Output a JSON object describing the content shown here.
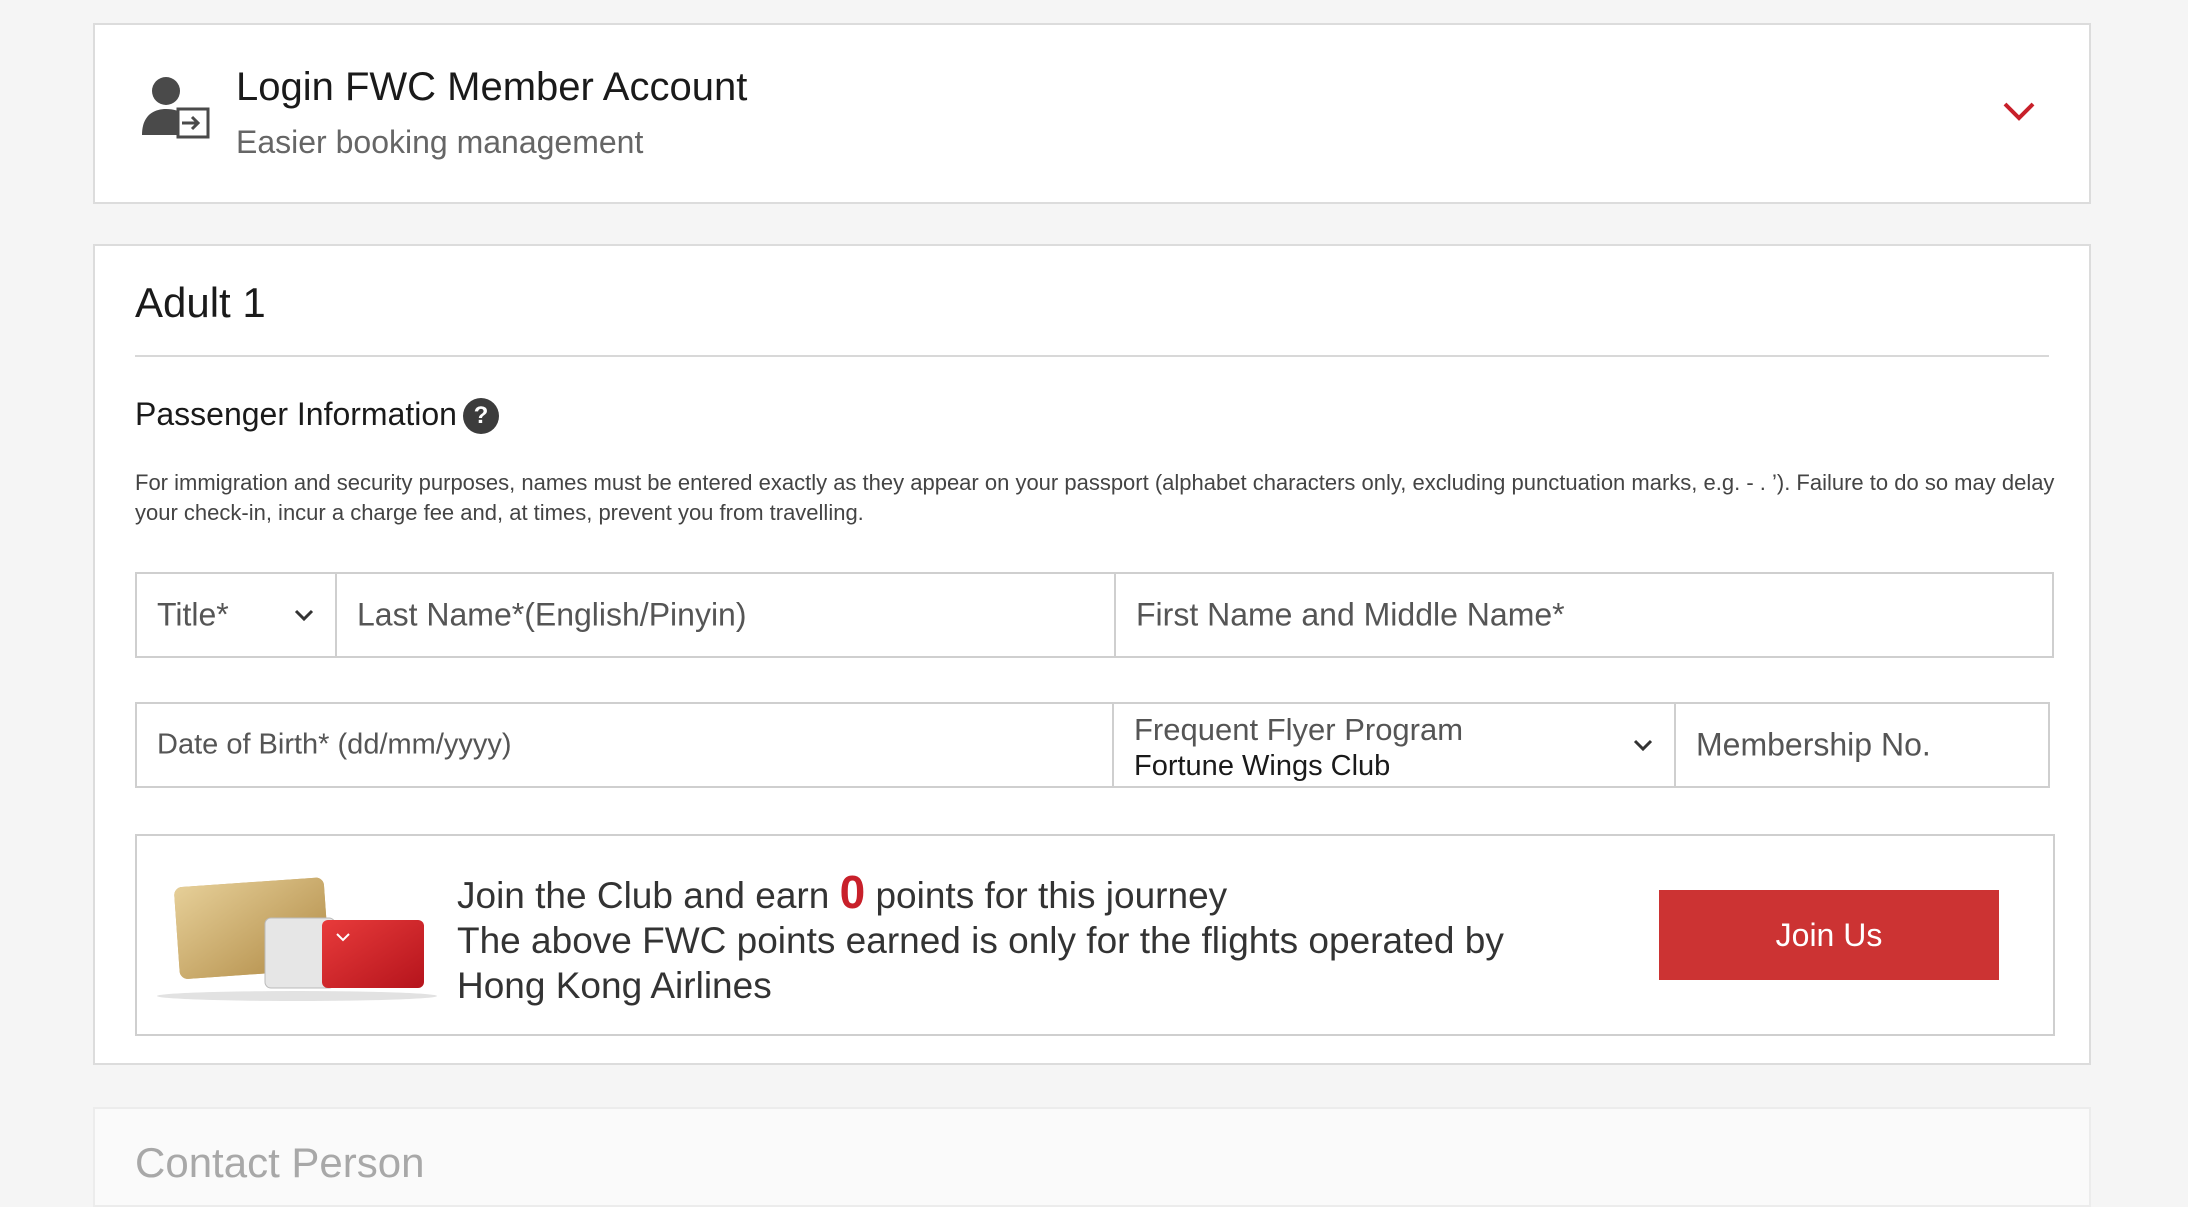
{
  "login": {
    "title": "Login FWC Member Account",
    "subtitle": "Easier booking management",
    "icon": "user-login-icon"
  },
  "passenger": {
    "heading": "Adult 1",
    "section_title": "Passenger Information",
    "help_symbol": "?",
    "notice": "For immigration and security purposes, names must be entered exactly as they appear on your passport (alphabet characters only, excluding punctuation marks, e.g. - . ’). Failure to do so may delay your check-in, incur a charge fee and, at times, prevent you from travelling.",
    "fields": {
      "title_placeholder": "Title*",
      "last_name_placeholder": "Last Name*(English/Pinyin)",
      "first_name_placeholder": "First Name and Middle Name*",
      "dob_placeholder": "Date of Birth* (dd/mm/yyyy)",
      "ffp_label": "Frequent Flyer Program",
      "ffp_value": "Fortune Wings Club",
      "membership_placeholder": "Membership No."
    },
    "join": {
      "line1_prefix": "Join the Club and earn ",
      "points": "0",
      "line1_suffix": " points for this journey",
      "line2": "The above FWC points earned is only for the flights operated by Hong Kong Airlines",
      "button": "Join Us"
    }
  },
  "contact": {
    "title": "Contact Person"
  },
  "colors": {
    "accent": "#cc3333",
    "chevron": "#c8202a",
    "background": "#f5f5f5"
  }
}
